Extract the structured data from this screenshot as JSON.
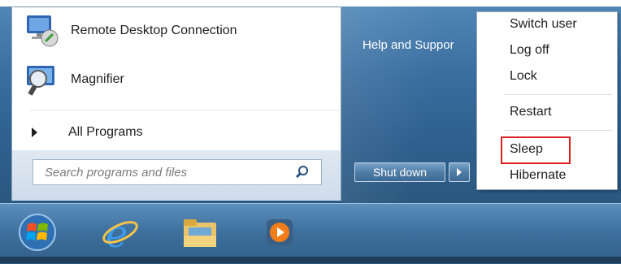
{
  "start_menu": {
    "programs": [
      {
        "label": "Remote Desktop Connection",
        "icon": "remote-desktop-icon"
      },
      {
        "label": "Magnifier",
        "icon": "magnifier-app-icon"
      }
    ],
    "all_programs_label": "All Programs",
    "search": {
      "placeholder": "Search programs and files",
      "icon": "search-icon"
    },
    "right_column": {
      "help_label": "Help and Suppor"
    },
    "shutdown_label": "Shut down"
  },
  "shutdown_submenu": {
    "items": [
      "Switch user",
      "Log off",
      "Lock",
      "Restart",
      "Sleep",
      "Hibernate"
    ],
    "highlighted": "Sleep",
    "highlight_color": "#e02020"
  },
  "taskbar": {
    "icons": [
      "windows-start-orb-icon",
      "internet-explorer-icon",
      "file-explorer-icon",
      "media-player-icon"
    ]
  }
}
